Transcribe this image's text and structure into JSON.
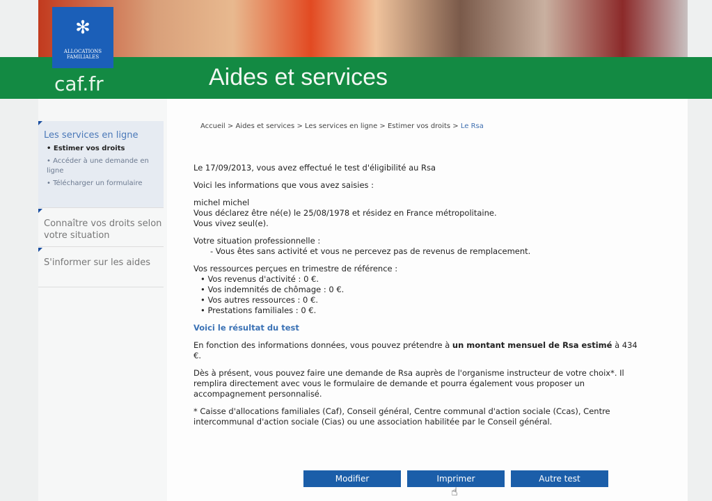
{
  "header": {
    "logo_text": "ALLOCATIONS FAMILIALES",
    "site": "caf.fr",
    "title": "Aides et services"
  },
  "sidebar": {
    "section1": {
      "title": "Les services en ligne",
      "items": [
        "Estimer vos droits",
        "Accéder à une demande en ligne",
        "Télécharger un formulaire"
      ]
    },
    "section2": "Connaître vos droits selon votre situation",
    "section3": "S'informer sur les aides"
  },
  "breadcrumb": {
    "items": [
      "Accueil",
      "Aides et services",
      "Les services en ligne",
      "Estimer vos droits"
    ],
    "current": "Le Rsa",
    "sep": " > "
  },
  "content": {
    "intro": "Le 17/09/2013, vous avez effectué le test d'éligibilité au Rsa",
    "info_title": "Voici les informations que vous avez saisies :",
    "name": "michel michel",
    "birth": "Vous déclarez être né(e) le 25/08/1978 et résidez en France métropolitaine.",
    "alone": "Vous vivez seul(e).",
    "pro_title": "Votre situation professionnelle :",
    "pro": "- Vous êtes sans activité et vous ne percevez pas de revenus de remplacement.",
    "res_title": "Vos ressources perçues en trimestre de référence :",
    "resources": [
      "Vos revenus d'activité : 0 €.",
      "Vos indemnités de chômage : 0 €.",
      "Vos autres ressources : 0 €.",
      "Prestations familiales : 0 €."
    ],
    "result_title": "Voici le résultat du test",
    "result_pre": "En fonction des informations données, vous pouvez prétendre à ",
    "result_bold": "un montant mensuel de Rsa estimé",
    "result_post": " à 434 €.",
    "demand": "Dès à présent, vous pouvez faire une demande de Rsa auprès de l'organisme instructeur de votre choix*. Il remplira directement avec vous le formulaire de demande et pourra également vous proposer un accompagnement personnalisé.",
    "footnote": "* Caisse d'allocations familiales (Caf), Conseil général, Centre communal d'action sociale (Ccas), Centre intercommunal d'action sociale (Cias) ou une association habilitée par le Conseil général."
  },
  "buttons": {
    "modify": "Modifier",
    "print": "Imprimer",
    "retry": "Autre test"
  }
}
